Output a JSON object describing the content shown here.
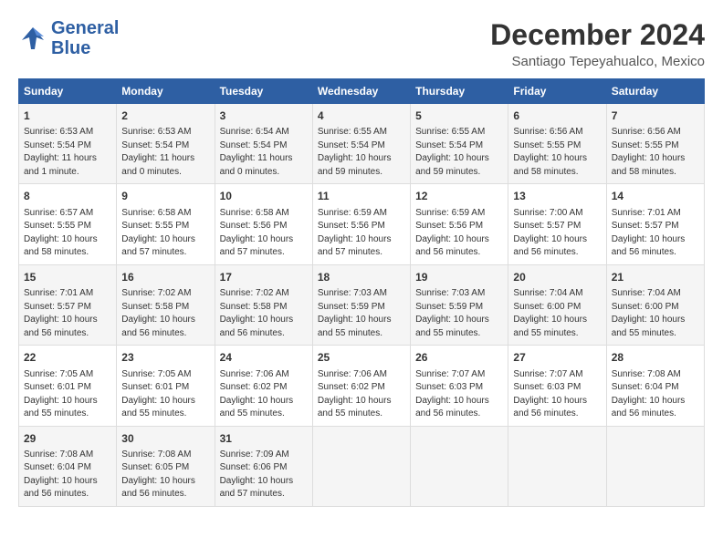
{
  "logo": {
    "line1": "General",
    "line2": "Blue"
  },
  "title": "December 2024",
  "location": "Santiago Tepeyahualco, Mexico",
  "days_of_week": [
    "Sunday",
    "Monday",
    "Tuesday",
    "Wednesday",
    "Thursday",
    "Friday",
    "Saturday"
  ],
  "weeks": [
    [
      {
        "day": "1",
        "info": "Sunrise: 6:53 AM\nSunset: 5:54 PM\nDaylight: 11 hours\nand 1 minute."
      },
      {
        "day": "2",
        "info": "Sunrise: 6:53 AM\nSunset: 5:54 PM\nDaylight: 11 hours\nand 0 minutes."
      },
      {
        "day": "3",
        "info": "Sunrise: 6:54 AM\nSunset: 5:54 PM\nDaylight: 11 hours\nand 0 minutes."
      },
      {
        "day": "4",
        "info": "Sunrise: 6:55 AM\nSunset: 5:54 PM\nDaylight: 10 hours\nand 59 minutes."
      },
      {
        "day": "5",
        "info": "Sunrise: 6:55 AM\nSunset: 5:54 PM\nDaylight: 10 hours\nand 59 minutes."
      },
      {
        "day": "6",
        "info": "Sunrise: 6:56 AM\nSunset: 5:55 PM\nDaylight: 10 hours\nand 58 minutes."
      },
      {
        "day": "7",
        "info": "Sunrise: 6:56 AM\nSunset: 5:55 PM\nDaylight: 10 hours\nand 58 minutes."
      }
    ],
    [
      {
        "day": "8",
        "info": "Sunrise: 6:57 AM\nSunset: 5:55 PM\nDaylight: 10 hours\nand 58 minutes."
      },
      {
        "day": "9",
        "info": "Sunrise: 6:58 AM\nSunset: 5:55 PM\nDaylight: 10 hours\nand 57 minutes."
      },
      {
        "day": "10",
        "info": "Sunrise: 6:58 AM\nSunset: 5:56 PM\nDaylight: 10 hours\nand 57 minutes."
      },
      {
        "day": "11",
        "info": "Sunrise: 6:59 AM\nSunset: 5:56 PM\nDaylight: 10 hours\nand 57 minutes."
      },
      {
        "day": "12",
        "info": "Sunrise: 6:59 AM\nSunset: 5:56 PM\nDaylight: 10 hours\nand 56 minutes."
      },
      {
        "day": "13",
        "info": "Sunrise: 7:00 AM\nSunset: 5:57 PM\nDaylight: 10 hours\nand 56 minutes."
      },
      {
        "day": "14",
        "info": "Sunrise: 7:01 AM\nSunset: 5:57 PM\nDaylight: 10 hours\nand 56 minutes."
      }
    ],
    [
      {
        "day": "15",
        "info": "Sunrise: 7:01 AM\nSunset: 5:57 PM\nDaylight: 10 hours\nand 56 minutes."
      },
      {
        "day": "16",
        "info": "Sunrise: 7:02 AM\nSunset: 5:58 PM\nDaylight: 10 hours\nand 56 minutes."
      },
      {
        "day": "17",
        "info": "Sunrise: 7:02 AM\nSunset: 5:58 PM\nDaylight: 10 hours\nand 56 minutes."
      },
      {
        "day": "18",
        "info": "Sunrise: 7:03 AM\nSunset: 5:59 PM\nDaylight: 10 hours\nand 55 minutes."
      },
      {
        "day": "19",
        "info": "Sunrise: 7:03 AM\nSunset: 5:59 PM\nDaylight: 10 hours\nand 55 minutes."
      },
      {
        "day": "20",
        "info": "Sunrise: 7:04 AM\nSunset: 6:00 PM\nDaylight: 10 hours\nand 55 minutes."
      },
      {
        "day": "21",
        "info": "Sunrise: 7:04 AM\nSunset: 6:00 PM\nDaylight: 10 hours\nand 55 minutes."
      }
    ],
    [
      {
        "day": "22",
        "info": "Sunrise: 7:05 AM\nSunset: 6:01 PM\nDaylight: 10 hours\nand 55 minutes."
      },
      {
        "day": "23",
        "info": "Sunrise: 7:05 AM\nSunset: 6:01 PM\nDaylight: 10 hours\nand 55 minutes."
      },
      {
        "day": "24",
        "info": "Sunrise: 7:06 AM\nSunset: 6:02 PM\nDaylight: 10 hours\nand 55 minutes."
      },
      {
        "day": "25",
        "info": "Sunrise: 7:06 AM\nSunset: 6:02 PM\nDaylight: 10 hours\nand 55 minutes."
      },
      {
        "day": "26",
        "info": "Sunrise: 7:07 AM\nSunset: 6:03 PM\nDaylight: 10 hours\nand 56 minutes."
      },
      {
        "day": "27",
        "info": "Sunrise: 7:07 AM\nSunset: 6:03 PM\nDaylight: 10 hours\nand 56 minutes."
      },
      {
        "day": "28",
        "info": "Sunrise: 7:08 AM\nSunset: 6:04 PM\nDaylight: 10 hours\nand 56 minutes."
      }
    ],
    [
      {
        "day": "29",
        "info": "Sunrise: 7:08 AM\nSunset: 6:04 PM\nDaylight: 10 hours\nand 56 minutes."
      },
      {
        "day": "30",
        "info": "Sunrise: 7:08 AM\nSunset: 6:05 PM\nDaylight: 10 hours\nand 56 minutes."
      },
      {
        "day": "31",
        "info": "Sunrise: 7:09 AM\nSunset: 6:06 PM\nDaylight: 10 hours\nand 57 minutes."
      },
      {
        "day": "",
        "info": ""
      },
      {
        "day": "",
        "info": ""
      },
      {
        "day": "",
        "info": ""
      },
      {
        "day": "",
        "info": ""
      }
    ]
  ]
}
